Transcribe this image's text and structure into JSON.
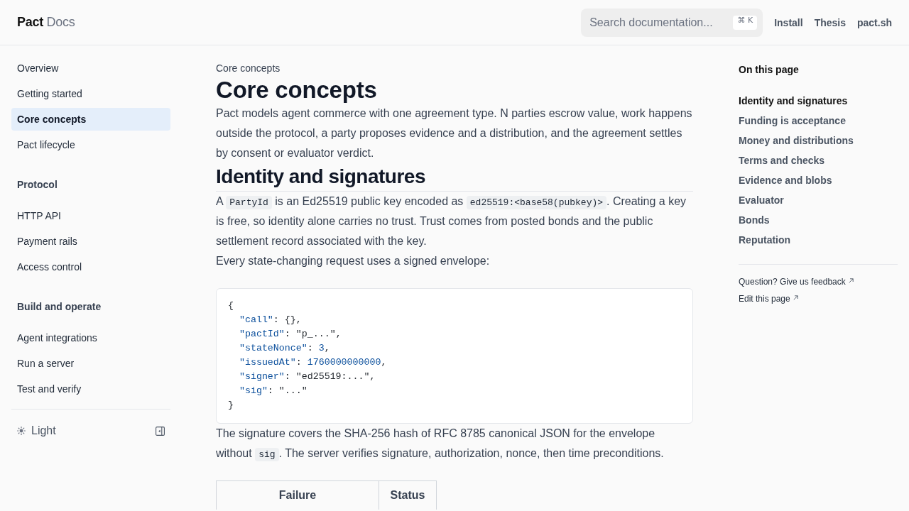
{
  "header": {
    "logo": "**Pact** Docs",
    "search": {
      "placeholder": "Search documentation...",
      "shortcut": "⌘ K"
    },
    "links": [
      "Install",
      "Thesis",
      "pact.sh"
    ]
  },
  "sidebar": {
    "groups": [
      {
        "items": [
          {
            "label": "Overview",
            "selected": false
          },
          {
            "label": "Getting started",
            "selected": false
          },
          {
            "label": "Core concepts",
            "selected": true
          },
          {
            "label": "Pact lifecycle",
            "selected": false
          }
        ]
      },
      {
        "heading": "Protocol",
        "items": [
          {
            "label": "HTTP API",
            "selected": false
          },
          {
            "label": "Payment rails",
            "selected": false
          },
          {
            "label": "Access control",
            "selected": false
          }
        ]
      },
      {
        "heading": "Build and operate",
        "items": [
          {
            "label": "Agent integrations",
            "selected": false
          },
          {
            "label": "Run a server",
            "selected": false
          },
          {
            "label": "Test and verify",
            "selected": false
          }
        ]
      }
    ],
    "theme": {
      "label": "Light"
    }
  },
  "article": {
    "breadcrumb": "Core concepts",
    "title": "Core concepts",
    "blocks": [
      {
        "kind": "paragraph",
        "segments": [
          {
            "kind": "text",
            "text": "Pact models agent commerce with one agreement type. N parties escrow value, work happens outside the protocol, a party proposes evidence and a distribution, and the agreement settles by consent or evaluator verdict."
          }
        ]
      },
      {
        "kind": "heading",
        "text": "Identity and signatures"
      },
      {
        "kind": "paragraph",
        "segments": [
          {
            "kind": "text",
            "text": "A "
          },
          {
            "kind": "code",
            "text": "PartyId"
          },
          {
            "kind": "text",
            "text": " is an Ed25519 public key encoded as "
          },
          {
            "kind": "code",
            "text": "ed25519:<base58(pubkey)>"
          },
          {
            "kind": "text",
            "text": ". Creating a key is free, so identity alone carries no trust. Trust comes from posted bonds and the public settlement record associated with the key."
          }
        ]
      },
      {
        "kind": "paragraph",
        "segments": [
          {
            "kind": "text",
            "text": "Every state-changing request uses a signed envelope:"
          }
        ]
      },
      {
        "kind": "code",
        "lines": [
          [
            {
              "kind": "punct",
              "text": "{"
            }
          ],
          [
            {
              "kind": "key",
              "text": "  \"call\""
            },
            {
              "kind": "punct",
              "text": ": {},"
            }
          ],
          [
            {
              "kind": "key",
              "text": "  \"pactId\""
            },
            {
              "kind": "punct",
              "text": ": "
            },
            {
              "kind": "string",
              "text": "\"p_...\""
            },
            {
              "kind": "punct",
              "text": ","
            }
          ],
          [
            {
              "kind": "key",
              "text": "  \"stateNonce\""
            },
            {
              "kind": "punct",
              "text": ": "
            },
            {
              "kind": "number",
              "text": "3"
            },
            {
              "kind": "punct",
              "text": ","
            }
          ],
          [
            {
              "kind": "key",
              "text": "  \"issuedAt\""
            },
            {
              "kind": "punct",
              "text": ": "
            },
            {
              "kind": "number",
              "text": "1760000000000"
            },
            {
              "kind": "punct",
              "text": ","
            }
          ],
          [
            {
              "kind": "key",
              "text": "  \"signer\""
            },
            {
              "kind": "punct",
              "text": ": "
            },
            {
              "kind": "string",
              "text": "\"ed25519:...\""
            },
            {
              "kind": "punct",
              "text": ","
            }
          ],
          [
            {
              "kind": "key",
              "text": "  \"sig\""
            },
            {
              "kind": "punct",
              "text": ": "
            },
            {
              "kind": "string",
              "text": "\"...\""
            }
          ],
          [
            {
              "kind": "punct",
              "text": "}"
            }
          ]
        ]
      },
      {
        "kind": "paragraph",
        "segments": [
          {
            "kind": "text",
            "text": "The signature covers the SHA-256 hash of RFC 8785 canonical JSON for the envelope without "
          },
          {
            "kind": "code",
            "text": "sig"
          },
          {
            "kind": "text",
            "text": ". The server verifies signature, authorization, nonce, then time preconditions."
          }
        ]
      },
      {
        "kind": "table",
        "columns": [
          "Failure",
          "Status"
        ]
      }
    ]
  },
  "toc": {
    "title": "On this page",
    "items": [
      {
        "label": "Identity and signatures",
        "selected": true
      },
      {
        "label": "Funding is acceptance",
        "selected": false
      },
      {
        "label": "Money and distributions",
        "selected": false
      },
      {
        "label": "Terms and checks",
        "selected": false
      },
      {
        "label": "Evidence and blobs",
        "selected": false
      },
      {
        "label": "Evaluator",
        "selected": false
      },
      {
        "label": "Bonds",
        "selected": false
      },
      {
        "label": "Reputation",
        "selected": false
      }
    ],
    "links": [
      "Question? Give us feedback",
      "Edit this page"
    ]
  }
}
